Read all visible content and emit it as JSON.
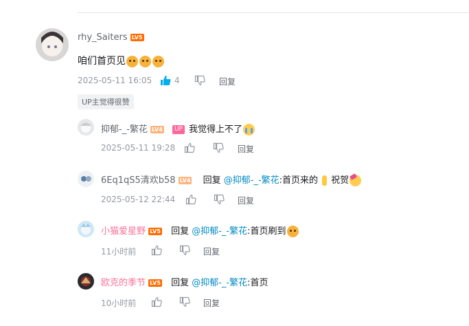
{
  "main_comment": {
    "username": "rhy_Saiters",
    "level": "LV5",
    "text": "咱们首页见",
    "time": "2025-05-11 16:05",
    "likes": "4",
    "reply_label": "回复",
    "up_tag": "UP主觉得很赞"
  },
  "replies": [
    {
      "username": "抑郁-_-繁花",
      "level": "LV4",
      "up_badge": "UP",
      "text": "我觉得上不了",
      "time": "2025-05-11 19:28",
      "reply_label": "回复"
    },
    {
      "username": "6Eq1qS5清欢b58",
      "level": "LV4",
      "reply_word": "回复",
      "mention": "@抑郁-_-繁花",
      "text_a": ":首页来的",
      "text_b": "祝贺",
      "time": "2025-05-12 22:44",
      "reply_label": "回复"
    },
    {
      "username": "小猫爱星野",
      "level": "LV5",
      "reply_word": "回复",
      "mention": "@抑郁-_-繁花",
      "text": ":首页刷到",
      "time": "11小时前",
      "reply_label": "回复"
    },
    {
      "username": "欧克的季节",
      "level": "LV5",
      "reply_word": "回复",
      "mention": "@抑郁-_-繁花",
      "text": ":首页",
      "time": "10小时前",
      "reply_label": "回复"
    }
  ],
  "colors": {
    "vip_name": "#fb7299",
    "mention": "#008ac5",
    "like_active": "#00aeec",
    "meta": "#9499a0"
  }
}
